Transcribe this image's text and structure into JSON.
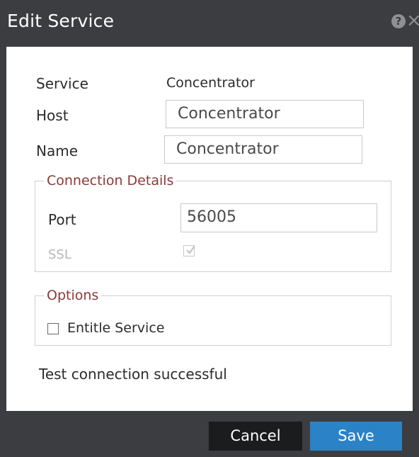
{
  "dialog": {
    "title": "Edit Service",
    "help_icon": "?",
    "close_icon": "×"
  },
  "form": {
    "service_label": "Service",
    "service_value": "Concentrator",
    "host_label": "Host",
    "host_value": "Concentrator",
    "name_label": "Name",
    "name_value": "Concentrator"
  },
  "connection": {
    "legend": "Connection Details",
    "port_label": "Port",
    "port_value": "56005",
    "ssl_label": "SSL",
    "ssl_checked": true,
    "ssl_disabled": true
  },
  "options": {
    "legend": "Options",
    "entitle_label": "Entitle Service",
    "entitle_checked": false
  },
  "status": {
    "message": "Test connection successful"
  },
  "footer": {
    "cancel_label": "Cancel",
    "save_label": "Save"
  },
  "colors": {
    "titlebar": "#3c3d40",
    "legend": "#8a3a36",
    "save_button": "#2b82c6",
    "cancel_button": "#1b1c1e"
  }
}
